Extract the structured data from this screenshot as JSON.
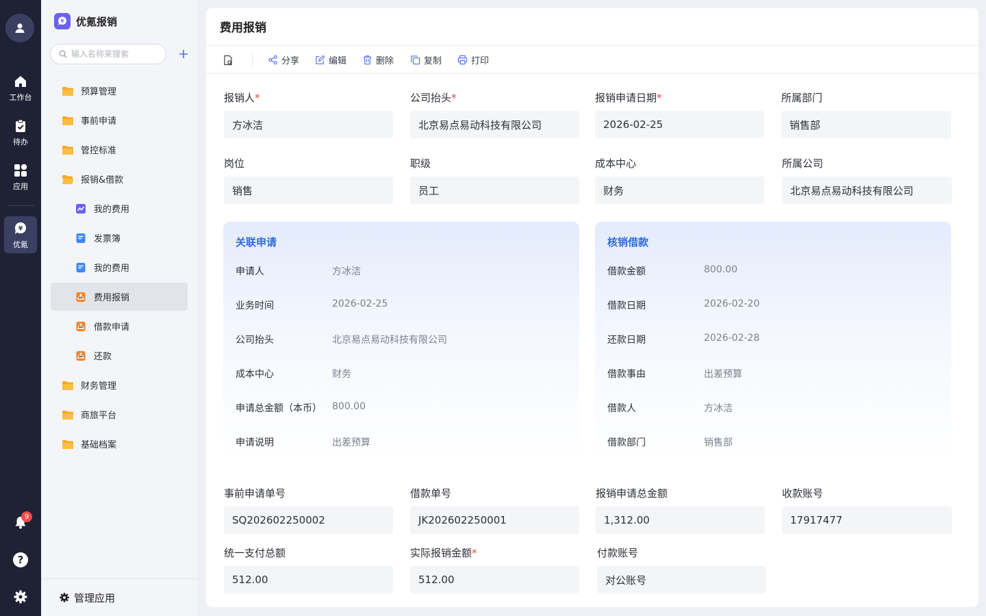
{
  "rail": {
    "items": [
      {
        "label": "工作台"
      },
      {
        "label": "待办"
      },
      {
        "label": "应用"
      },
      {
        "label": "优氪"
      }
    ],
    "notification_count": "9"
  },
  "sidebar": {
    "brand": "优氪报销",
    "search_placeholder": "输入名称来搜索",
    "items": [
      {
        "label": "预算管理"
      },
      {
        "label": "事前申请"
      },
      {
        "label": "管控标准"
      },
      {
        "label": "报销&借款"
      },
      {
        "label": "我的费用"
      },
      {
        "label": "发票簿"
      },
      {
        "label": "我的费用"
      },
      {
        "label": "费用报销"
      },
      {
        "label": "借款申请"
      },
      {
        "label": "还款"
      },
      {
        "label": "财务管理"
      },
      {
        "label": "商旅平台"
      },
      {
        "label": "基础档案"
      }
    ],
    "manage_label": "管理应用"
  },
  "main": {
    "title": "费用报销",
    "toolbar": {
      "share": "分享",
      "edit": "编辑",
      "delete": "删除",
      "copy": "复制",
      "print": "打印"
    },
    "fields_top": [
      {
        "label": "报销人",
        "value": "方冰洁",
        "required": "*"
      },
      {
        "label": "公司抬头",
        "value": "北京易点易动科技有限公司",
        "required": "*"
      },
      {
        "label": "报销申请日期",
        "value": "2026-02-25",
        "required": "*"
      },
      {
        "label": "所属部门",
        "value": "销售部",
        "required": ""
      },
      {
        "label": "岗位",
        "value": "销售",
        "required": ""
      },
      {
        "label": "职级",
        "value": "员工",
        "required": ""
      },
      {
        "label": "成本中心",
        "value": "财务",
        "required": ""
      },
      {
        "label": "所属公司",
        "value": "北京易点易动科技有限公司",
        "required": ""
      }
    ],
    "related_application": {
      "title": "关联申请",
      "rows": [
        {
          "label": "申请人",
          "value": "方冰洁"
        },
        {
          "label": "业务时间",
          "value": "2026-02-25"
        },
        {
          "label": "公司抬头",
          "value": "北京易点易动科技有限公司"
        },
        {
          "label": "成本中心",
          "value": "财务"
        },
        {
          "label": "申请总金额（本币）",
          "value": "800.00"
        },
        {
          "label": "申请说明",
          "value": "出差预算"
        }
      ]
    },
    "loan_writeoff": {
      "title": "核销借款",
      "rows": [
        {
          "label": "借款金额",
          "value": "800.00"
        },
        {
          "label": "借款日期",
          "value": "2026-02-20"
        },
        {
          "label": "还款日期",
          "value": "2026-02-28"
        },
        {
          "label": "借款事由",
          "value": "出差预算"
        },
        {
          "label": "借款人",
          "value": "方冰洁"
        },
        {
          "label": "借款部门",
          "value": "销售部"
        }
      ]
    },
    "fields_bottom": [
      {
        "label": "事前申请单号",
        "value": "SQ202602250002",
        "required": ""
      },
      {
        "label": "借款单号",
        "value": "JK202602250001",
        "required": ""
      },
      {
        "label": "报销申请总金额",
        "value": "1,312.00",
        "required": ""
      },
      {
        "label": "收款账号",
        "value": "17917477",
        "required": ""
      },
      {
        "label": "统一支付总额",
        "value": "512.00",
        "required": ""
      },
      {
        "label": "实际报销金额",
        "value": "512.00",
        "required": "*"
      },
      {
        "label": "付款账号",
        "value": "对公账号",
        "required": ""
      }
    ]
  },
  "colors": {
    "rail_bg": "#1f2235",
    "accent": "#4d6bf5",
    "panel_title": "#2f6bdc",
    "required": "#e8433b",
    "folder": "#f7a928"
  }
}
